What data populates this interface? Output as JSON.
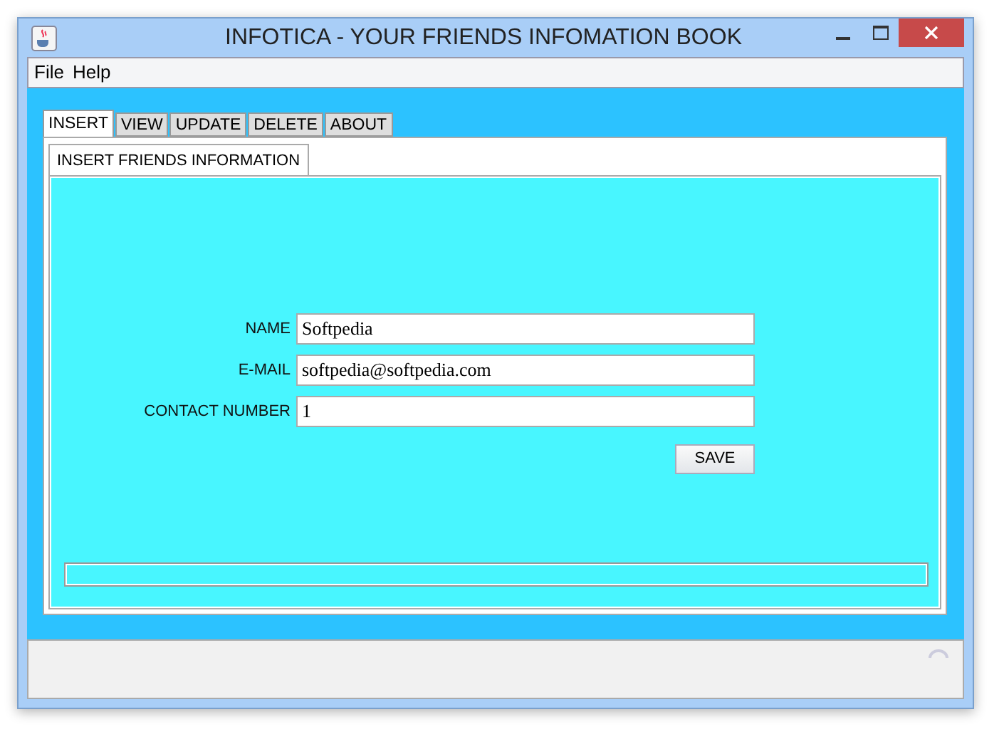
{
  "window": {
    "title": "INFOTICA - YOUR FRIENDS INFOMATION BOOK"
  },
  "menu": [
    "File",
    "Help"
  ],
  "tabs": [
    {
      "label": "INSERT",
      "selected": true
    },
    {
      "label": "VIEW",
      "selected": false
    },
    {
      "label": "UPDATE",
      "selected": false
    },
    {
      "label": "DELETE",
      "selected": false
    },
    {
      "label": "ABOUT",
      "selected": false
    }
  ],
  "subtabs": [
    {
      "label": "INSERT FRIENDS INFORMATION",
      "selected": true
    }
  ],
  "form": {
    "fields": [
      {
        "label": "NAME",
        "value": "Softpedia"
      },
      {
        "label": "E-MAIL",
        "value": "softpedia@softpedia.com"
      },
      {
        "label": "CONTACT NUMBER",
        "value": "1"
      }
    ],
    "save_button": "SAVE"
  }
}
